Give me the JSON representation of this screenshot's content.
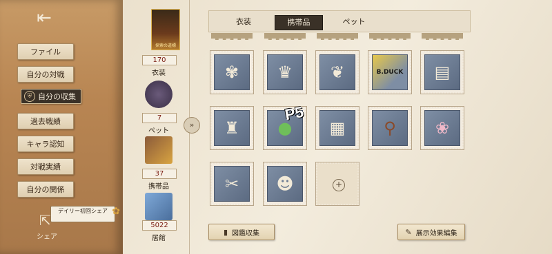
{
  "sidebar": {
    "exit_icon": "exit-door-icon",
    "items": [
      {
        "label": "ファイル"
      },
      {
        "label": "自分の対戦"
      },
      {
        "label": "自分の収集",
        "active": true
      },
      {
        "label": "過去戦績"
      },
      {
        "label": "キャラ認知"
      },
      {
        "label": "対戦実績"
      },
      {
        "label": "自分の関係"
      }
    ],
    "share_label": "シェア",
    "daily_tag": "デイリー初回シェア"
  },
  "summary": {
    "costume": {
      "card_title": "探索の道標",
      "count": "170",
      "label": "衣装"
    },
    "pet": {
      "count": "7",
      "label": "ペット"
    },
    "accessory": {
      "count": "37",
      "label": "携帯品"
    },
    "residence": {
      "count": "5022",
      "label": "居館"
    }
  },
  "tabs": [
    {
      "label": "衣装"
    },
    {
      "label": "携帯品",
      "active": true
    },
    {
      "label": "ペット"
    }
  ],
  "items": [
    {
      "icon": "flower-bouquet-icon"
    },
    {
      "icon": "jester-puppet-icon"
    },
    {
      "icon": "blue-fish-icon"
    },
    {
      "icon": "bee-duck-icon",
      "text": "B.DUCK"
    },
    {
      "icon": "leather-book-icon"
    },
    {
      "icon": "dark-lantern-icon"
    },
    {
      "icon": "green-orb-icon",
      "overlay": "P5"
    },
    {
      "icon": "iron-cage-icon"
    },
    {
      "icon": "hand-mirror-icon"
    },
    {
      "icon": "blossom-branch-icon"
    },
    {
      "icon": "scissors-icon"
    },
    {
      "icon": "voodoo-doll-icon"
    }
  ],
  "bottom": {
    "catalog_label": "図鑑収集",
    "display_label": "展示効果編集"
  },
  "colors": {
    "active_tab": "#3a3127",
    "sidebar": "#b88552",
    "stamp": "#6e7e95"
  }
}
